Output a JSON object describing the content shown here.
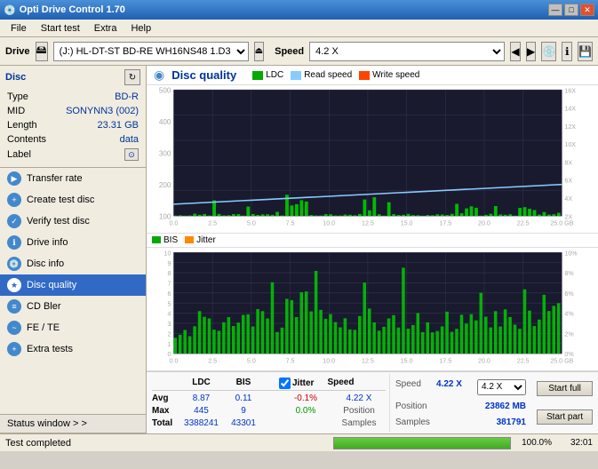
{
  "app": {
    "title": "Opti Drive Control 1.70",
    "icon": "💿"
  },
  "window_controls": {
    "minimize": "—",
    "maximize": "□",
    "close": "✕"
  },
  "menu": {
    "items": [
      "File",
      "Start test",
      "Extra",
      "Help"
    ]
  },
  "drive_bar": {
    "label": "Drive",
    "drive_value": "(J:)  HL-DT-ST BD-RE  WH16NS48 1.D3",
    "speed_label": "Speed",
    "speed_value": "4.2 X"
  },
  "disc_panel": {
    "title": "Disc",
    "refresh_icon": "↻",
    "fields": [
      {
        "label": "Type",
        "value": "BD-R",
        "color": "blue"
      },
      {
        "label": "MID",
        "value": "SONYNN3 (002)",
        "color": "blue"
      },
      {
        "label": "Length",
        "value": "23.31 GB",
        "color": "normal"
      },
      {
        "label": "Contents",
        "value": "data",
        "color": "blue"
      },
      {
        "label": "Label",
        "value": "",
        "color": "normal"
      }
    ]
  },
  "nav_items": [
    {
      "label": "Transfer rate",
      "id": "transfer-rate"
    },
    {
      "label": "Create test disc",
      "id": "create-test-disc"
    },
    {
      "label": "Verify test disc",
      "id": "verify-test-disc"
    },
    {
      "label": "Drive info",
      "id": "drive-info"
    },
    {
      "label": "Disc info",
      "id": "disc-info"
    },
    {
      "label": "Disc quality",
      "id": "disc-quality",
      "active": true
    },
    {
      "label": "CD Bler",
      "id": "cd-bler"
    },
    {
      "label": "FE / TE",
      "id": "fe-te"
    },
    {
      "label": "Extra tests",
      "id": "extra-tests"
    }
  ],
  "status_window": {
    "label": "Status window > >",
    "test_completed": "Test completed"
  },
  "chart": {
    "title": "Disc quality",
    "legend": [
      {
        "label": "LDC",
        "color": "#00aa00"
      },
      {
        "label": "Read speed",
        "color": "#88ccff"
      },
      {
        "label": "Write speed",
        "color": "#ff4400"
      }
    ],
    "legend2": [
      {
        "label": "BIS",
        "color": "#00aa00"
      },
      {
        "label": "Jitter",
        "color": "#ff8800"
      }
    ],
    "y_axis_ldc": [
      "500",
      "400",
      "300",
      "200",
      "100"
    ],
    "y_axis_speed": [
      "16X",
      "14X",
      "12X",
      "10X",
      "8X",
      "6X",
      "4X",
      "2X"
    ],
    "x_axis": [
      "0.0",
      "2.5",
      "5.0",
      "7.5",
      "10.0",
      "12.5",
      "15.0",
      "17.5",
      "20.0",
      "22.5",
      "25.0 GB"
    ]
  },
  "stats": {
    "headers": [
      "LDC",
      "BIS",
      "",
      "Jitter",
      "Speed"
    ],
    "rows": [
      {
        "label": "Avg",
        "ldc": "8.87",
        "bis": "0.11",
        "jitter": "-0.1%",
        "speed": "4.22 X"
      },
      {
        "label": "Max",
        "ldc": "445",
        "bis": "9",
        "jitter": "0.0%",
        "speed_label": "Position",
        "position": "23862 MB"
      },
      {
        "label": "Total",
        "ldc": "3388241",
        "bis": "43301",
        "jitter": "",
        "speed_label": "Samples",
        "samples": "381791"
      }
    ],
    "jitter_checked": true,
    "speed_display": "4.2 X",
    "buttons": {
      "start_full": "Start full",
      "start_part": "Start part"
    }
  },
  "statusbar": {
    "text": "Test completed",
    "progress": 100,
    "progress_text": "100.0%",
    "time": "32:01"
  }
}
